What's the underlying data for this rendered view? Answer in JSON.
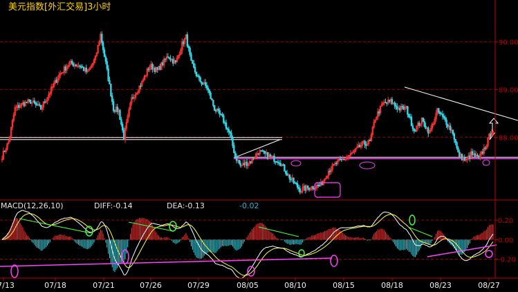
{
  "title": "美元指数[外汇交易]3小时",
  "price_axis": [
    "90.00",
    "89.00",
    "88.00"
  ],
  "macd_axis": [
    "0.20",
    "0.00",
    "-0.20"
  ],
  "dates": [
    "07/13",
    "07/18",
    "07/21",
    "07/26",
    "07/29",
    "08/05",
    "08/10",
    "08/15",
    "08/18",
    "08/23",
    "08/27"
  ],
  "macd_header": {
    "name": "MACD(12,26,10)",
    "diff": "DIFF:-0.14",
    "dea": "DEA:-0.13",
    "macd": "-0.02"
  },
  "colors": {
    "background": "#000000",
    "up": "#ff3030",
    "down": "#30d8e8",
    "grid": "#a00000",
    "axis": "#c00000",
    "title": "#ffd200",
    "diff_line": "#ffffff",
    "dea_line": "#ffff40",
    "support": "#ff40ff",
    "trend": "#ffffff",
    "macd_trend": "#40ff40",
    "marker_magenta": "#ff40ff",
    "marker_green": "#40ff40"
  },
  "chart_data": {
    "type": "candlestick",
    "title": "美元指数[外汇交易]3小时",
    "x_tick_labels": [
      "07/13",
      "07/18",
      "07/21",
      "07/26",
      "07/29",
      "08/05",
      "08/10",
      "08/15",
      "08/18",
      "08/23",
      "08/27"
    ],
    "y_ticks": [
      90.0,
      89.0,
      88.0
    ],
    "ylim": [
      86.7,
      90.7
    ],
    "anchors": [
      [
        0,
        87.6
      ],
      [
        5,
        87.9
      ],
      [
        10,
        88.6
      ],
      [
        16,
        88.7
      ],
      [
        22,
        88.75
      ],
      [
        30,
        88.6
      ],
      [
        36,
        88.9
      ],
      [
        44,
        89.3
      ],
      [
        52,
        89.55
      ],
      [
        60,
        89.5
      ],
      [
        66,
        89.35
      ],
      [
        72,
        89.65
      ],
      [
        76,
        90.15
      ],
      [
        80,
        89.55
      ],
      [
        86,
        88.6
      ],
      [
        90,
        88.55
      ],
      [
        94,
        88.0
      ],
      [
        100,
        88.8
      ],
      [
        108,
        89.15
      ],
      [
        114,
        89.5
      ],
      [
        120,
        89.4
      ],
      [
        128,
        89.7
      ],
      [
        134,
        89.55
      ],
      [
        139,
        89.95
      ],
      [
        142,
        90.1
      ],
      [
        146,
        89.55
      ],
      [
        152,
        89.2
      ],
      [
        158,
        89.05
      ],
      [
        164,
        88.6
      ],
      [
        170,
        88.4
      ],
      [
        176,
        88.05
      ],
      [
        180,
        87.6
      ],
      [
        184,
        87.4
      ],
      [
        192,
        87.5
      ],
      [
        198,
        87.7
      ],
      [
        206,
        87.6
      ],
      [
        214,
        87.5
      ],
      [
        222,
        87.15
      ],
      [
        230,
        86.9
      ],
      [
        238,
        86.95
      ],
      [
        246,
        87.0
      ],
      [
        252,
        87.3
      ],
      [
        258,
        87.45
      ],
      [
        264,
        87.55
      ],
      [
        270,
        87.65
      ],
      [
        278,
        87.85
      ],
      [
        284,
        87.9
      ],
      [
        288,
        88.4
      ],
      [
        294,
        88.7
      ],
      [
        300,
        88.75
      ],
      [
        306,
        88.6
      ],
      [
        312,
        88.6
      ],
      [
        318,
        88.15
      ],
      [
        324,
        88.35
      ],
      [
        330,
        88.1
      ],
      [
        336,
        88.55
      ],
      [
        342,
        88.35
      ],
      [
        348,
        88.1
      ],
      [
        352,
        87.65
      ],
      [
        358,
        87.5
      ],
      [
        362,
        87.65
      ],
      [
        368,
        87.55
      ],
      [
        373,
        87.8
      ],
      [
        378,
        88.15
      ]
    ],
    "support_level": 87.58,
    "neckline_level": 87.95,
    "macd": {
      "name": "MACD(12,26,10)",
      "diff": -0.14,
      "dea": -0.13,
      "macd": -0.02,
      "y_ticks": [
        0.2,
        0.0,
        -0.2
      ],
      "ylim": [
        -0.38,
        0.3
      ]
    }
  }
}
